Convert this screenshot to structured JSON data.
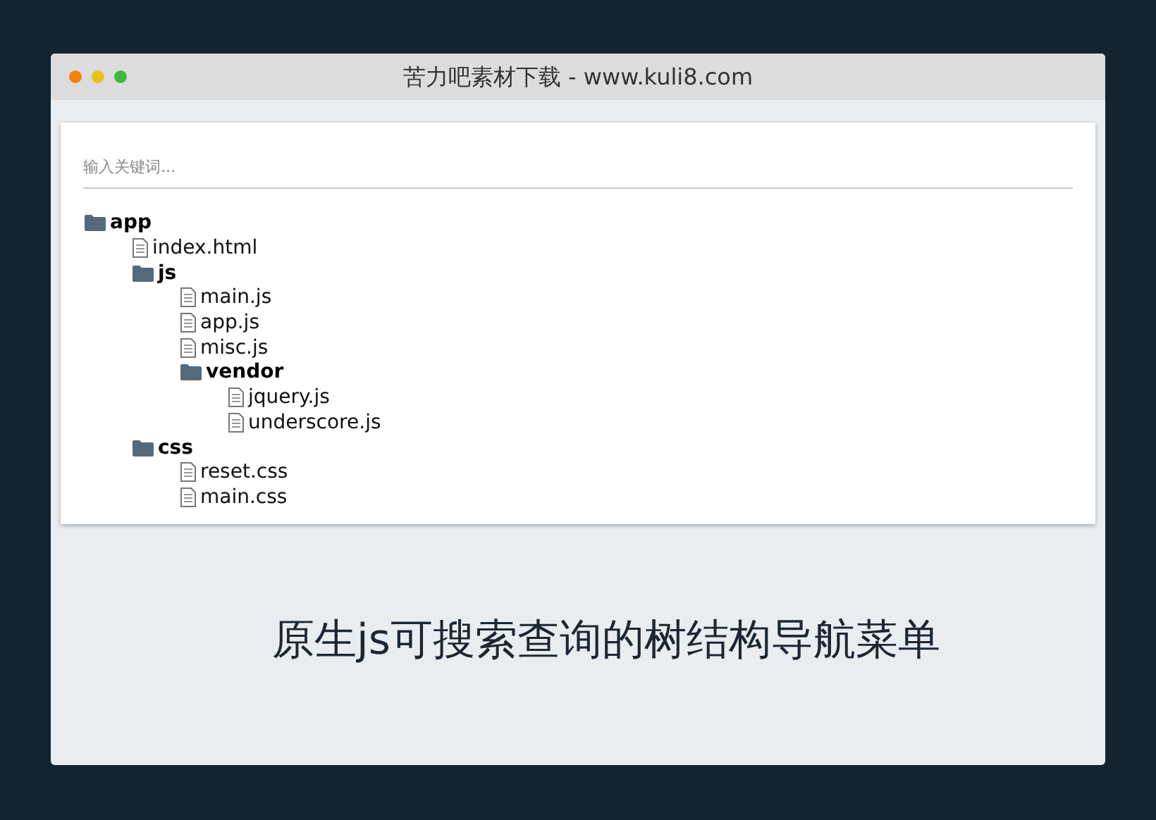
{
  "window": {
    "title": "苦力吧素材下载 - www.kuli8.com"
  },
  "search": {
    "placeholder": "输入关键词..."
  },
  "tree": [
    {
      "kind": "folder",
      "label": "app",
      "children": [
        {
          "kind": "file",
          "label": "index.html"
        },
        {
          "kind": "folder",
          "label": "js",
          "children": [
            {
              "kind": "file",
              "label": "main.js"
            },
            {
              "kind": "file",
              "label": "app.js"
            },
            {
              "kind": "file",
              "label": "misc.js"
            },
            {
              "kind": "folder",
              "label": "vendor",
              "children": [
                {
                  "kind": "file",
                  "label": "jquery.js"
                },
                {
                  "kind": "file",
                  "label": "underscore.js"
                }
              ]
            }
          ]
        },
        {
          "kind": "folder",
          "label": "css",
          "children": [
            {
              "kind": "file",
              "label": "reset.css"
            },
            {
              "kind": "file",
              "label": "main.css"
            }
          ]
        }
      ]
    }
  ],
  "caption": "原生js可搜索查询的树结构导航菜单"
}
